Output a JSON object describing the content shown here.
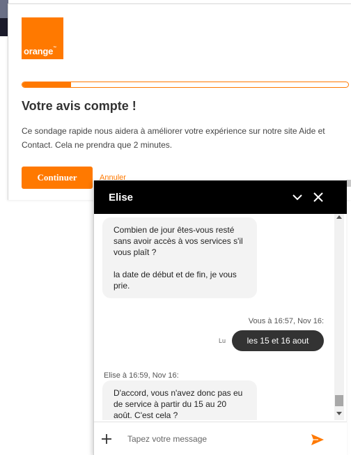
{
  "survey": {
    "logo_text": "orange",
    "logo_mark": "™",
    "progress_percent": 15,
    "title": "Votre avis compte !",
    "description": "Ce sondage rapide nous aidera à améliorer votre expérience sur notre site Aide et Contact. Cela ne prendra que 2 minutes.",
    "continue_label": "Continuer",
    "cancel_label": "Annuler"
  },
  "chat": {
    "agent_name": "Elise",
    "minimize_icon": "chevron-down-icon",
    "close_icon": "close-icon",
    "messages": {
      "agent_1_line1": "Combien de jour êtes-vous resté sans avoir accès à vos services s'il vous plaît ?",
      "agent_1_line2": "la date de début et de fin, je vous prie.",
      "user_meta": "Vous à 16:57, Nov 16:",
      "user_read": "Lu",
      "user_text": "les 15 et 16 aout",
      "agent_2_meta": "Elise à 16:59, Nov 16:",
      "agent_2_text": "D'accord, vous n'avez donc pas eu de service à partir du 15 au 20 août. C'est cela ?"
    },
    "input_placeholder": "Tapez votre message",
    "colors": {
      "accent": "#ff7900",
      "header": "#000000",
      "user_bubble": "#333333",
      "agent_bubble": "#f3f3f3"
    }
  }
}
